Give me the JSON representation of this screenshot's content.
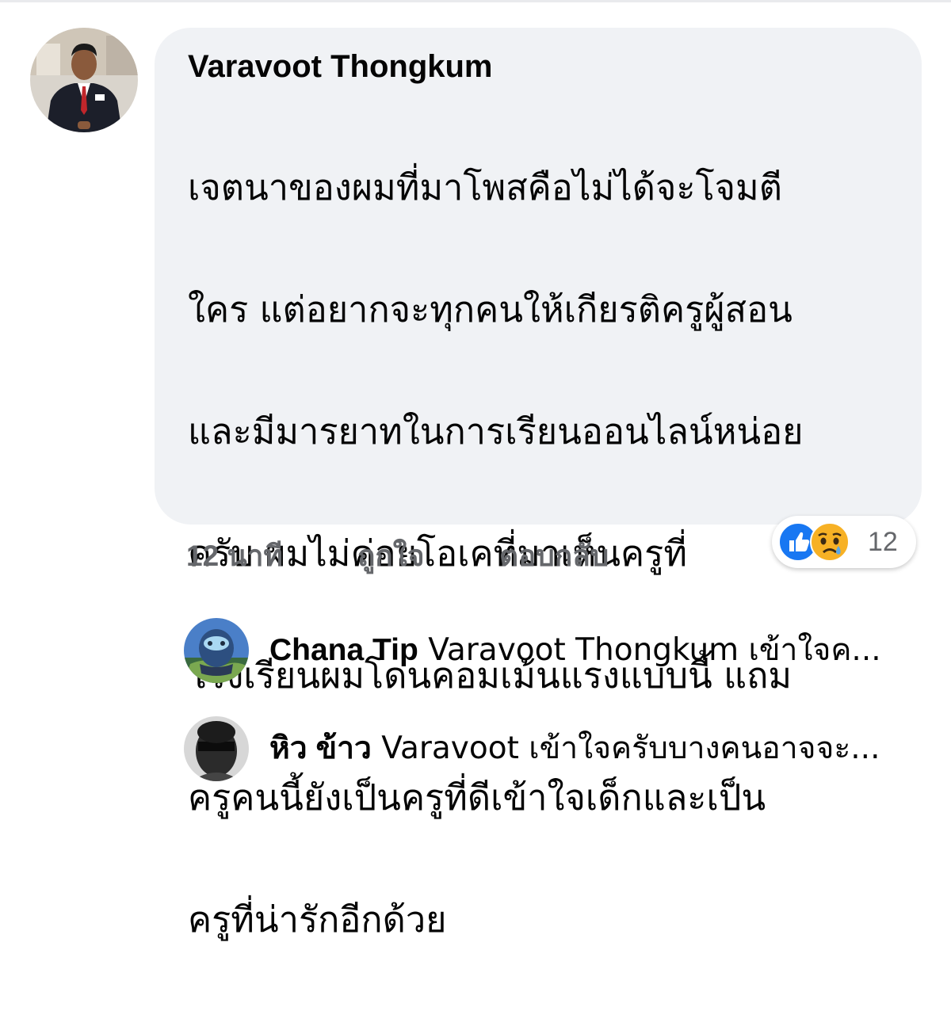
{
  "comment": {
    "author": "Varavoot Thongkum",
    "lines": [
      "เจตนาของผมที่มาโพสคือไม่ได้จะโจมตี",
      "ใคร แต่อยากจะทุกคนให้เกียรติครูผู้สอน",
      "และมีมารยาทในการเรียนออนไลน์หน่อย",
      "ครับ ผมไม่ค่อยโอเคที่มาเห็นครูที่",
      "โรงเรียนผมโดนคอมเม้นแรงแบบนี้ แถม",
      "ครูคนนี้ยังเป็นครูที่ดีเข้าใจเด็กและเป็น",
      "ครูที่น่ารักอีกด้วย"
    ],
    "time": "12 นาที",
    "like_label": "ถูกใจ",
    "reply_label": "ตอบกลับ",
    "reactions": {
      "icons": [
        "like-icon",
        "sad-icon"
      ],
      "count": "12"
    }
  },
  "replies": [
    {
      "name": "Chana Tip",
      "snippet": " Varavoot Thongkum เข้าใจค..."
    },
    {
      "name": "หิว ข้าว",
      "snippet": " Varavoot เข้าใจครับบางคนอาจจะ..."
    }
  ],
  "colors": {
    "bubble": "#f0f2f5",
    "muted_text": "#65676b",
    "like_blue": "#1877f2",
    "sad_yellow": "#f7b125"
  }
}
